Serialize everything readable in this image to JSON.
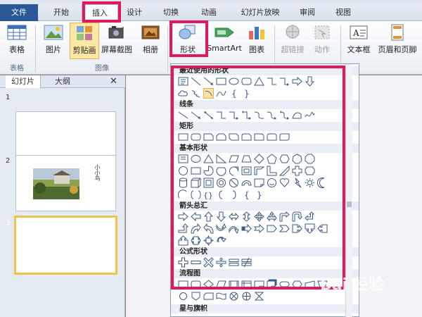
{
  "tabs": [
    {
      "label": "文件"
    },
    {
      "label": "开始"
    },
    {
      "label": "插入"
    },
    {
      "label": "设计"
    },
    {
      "label": "切换"
    },
    {
      "label": "动画"
    },
    {
      "label": "幻灯片放映"
    },
    {
      "label": "审阅"
    },
    {
      "label": "视图"
    }
  ],
  "ribbon": {
    "table": {
      "label": "表格",
      "group": "表格"
    },
    "picture": {
      "label": "图片"
    },
    "clipart": {
      "label": "剪贴画"
    },
    "screenshot": {
      "label": "屏幕截图"
    },
    "album": {
      "label": "相册"
    },
    "images_group": "图像",
    "shapes": {
      "label": "形状"
    },
    "smartart": {
      "label": "SmartArt"
    },
    "chart": {
      "label": "图表"
    },
    "hyperlink": {
      "label": "超链接"
    },
    "action": {
      "label": "动作"
    },
    "textbox": {
      "label": "文本框"
    },
    "headerfooter": {
      "label": "页眉和页脚"
    }
  },
  "left_pane": {
    "tab_slides": "幻灯片",
    "tab_outline": "大纲",
    "close": "✕",
    "slides": [
      {
        "num": "1"
      },
      {
        "num": "2",
        "caption": "小小鸟"
      },
      {
        "num": "3"
      }
    ]
  },
  "gallery": {
    "sections": [
      "最近使用的形状",
      "线条",
      "矩形",
      "基本形状",
      "箭头总汇",
      "公式形状",
      "流程图",
      "星与旗帜"
    ]
  },
  "watermark": "Bai 经验",
  "colors": {
    "highlight": "#e0195e",
    "file_tab": "#2b5797"
  }
}
